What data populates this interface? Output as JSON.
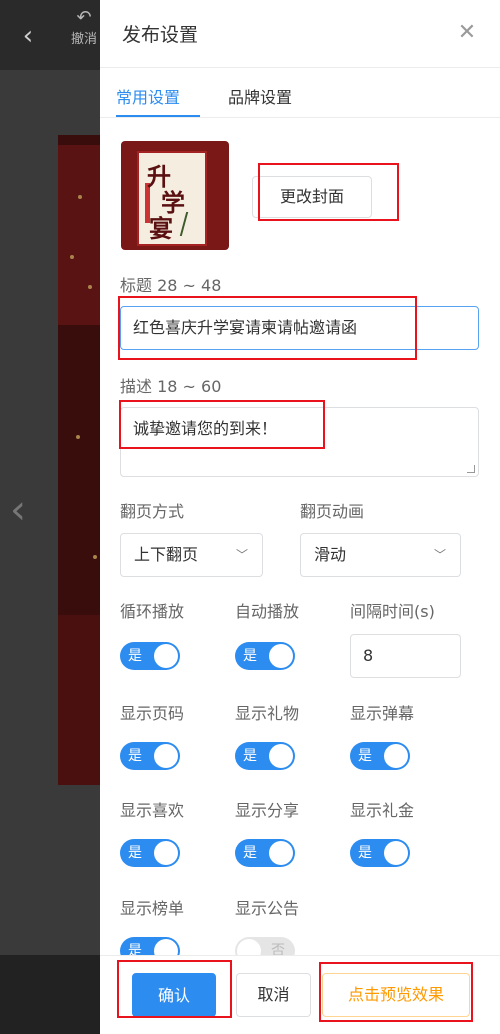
{
  "background": {
    "undo_label": "撤消"
  },
  "panel": {
    "title": "发布设置",
    "tabs": [
      {
        "label": "常用设置",
        "active": true
      },
      {
        "label": "品牌设置",
        "active": false
      }
    ]
  },
  "cover": {
    "change_cover_label": "更改封面",
    "cover_text": "升学宴"
  },
  "title_field": {
    "label": "标题 28 ~ 48",
    "value": "红色喜庆升学宴请柬请帖邀请函"
  },
  "description_field": {
    "label": "描述 18 ~ 60",
    "value": "诚挚邀请您的到来！"
  },
  "page_turn": {
    "mode_label": "翻页方式",
    "mode_value": "上下翻页",
    "animation_label": "翻页动画",
    "animation_value": "滑动"
  },
  "playback": {
    "loop_label": "循环播放",
    "loop_on": true,
    "auto_label": "自动播放",
    "auto_on": true,
    "interval_label": "间隔时间(s)",
    "interval_value": "8"
  },
  "display": {
    "page_number_label": "显示页码",
    "gift_label": "显示礼物",
    "danmaku_label": "显示弹幕",
    "like_label": "显示喜欢",
    "share_label": "显示分享",
    "cash_gift_label": "显示礼金",
    "ranking_label": "显示榜单",
    "announcement_label": "显示公告",
    "announcement_on": false
  },
  "toggle_text": {
    "on": "是",
    "off": "否"
  },
  "footer": {
    "confirm_label": "确认",
    "cancel_label": "取消",
    "preview_label": "点击预览效果"
  },
  "colors": {
    "accent": "#2d8cf0",
    "preview": "#ff9900",
    "highlight": "#e8131d"
  }
}
